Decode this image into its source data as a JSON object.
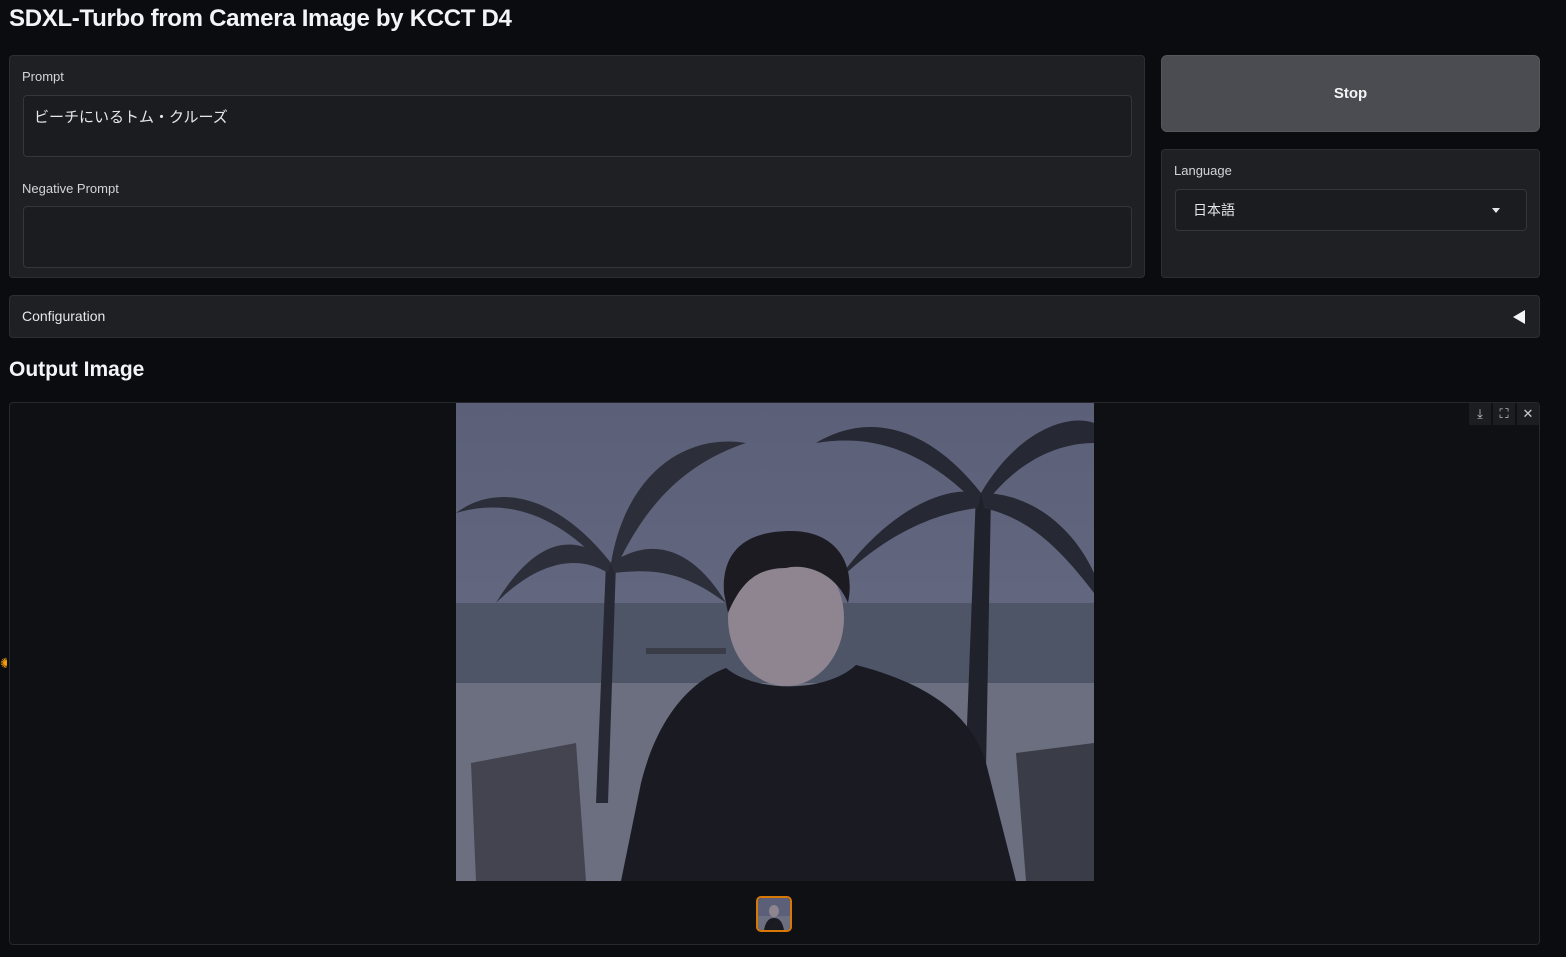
{
  "app": {
    "title": "SDXL-Turbo from Camera Image by KCCT D4"
  },
  "inputs": {
    "prompt_label": "Prompt",
    "prompt_value": "ビーチにいるトム・クルーズ",
    "negative_label": "Negative Prompt",
    "negative_value": ""
  },
  "controls": {
    "stop_label": "Stop",
    "language_label": "Language",
    "language_value": "日本語"
  },
  "configuration": {
    "label": "Configuration"
  },
  "output": {
    "title": "Output Image",
    "tools": {
      "download_icon": "download-icon",
      "fullscreen_icon": "fullscreen-icon",
      "close_icon": "close-icon"
    }
  },
  "colors": {
    "background": "#0b0c0f",
    "panel": "#1f2023",
    "button": "#4b4c51",
    "thumb_border": "#d97706"
  }
}
